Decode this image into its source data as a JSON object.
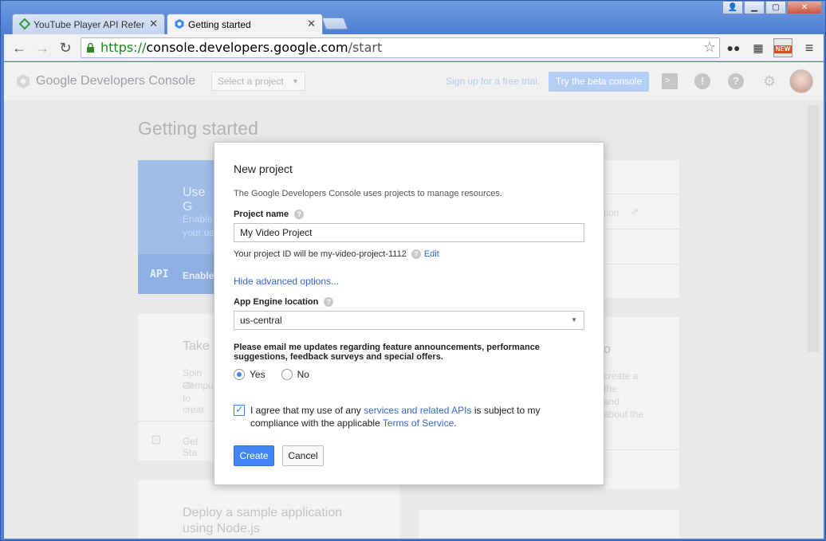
{
  "browser": {
    "tabs": [
      {
        "title": "YouTube Player API Referen",
        "active": false
      },
      {
        "title": "Getting started",
        "active": true
      }
    ],
    "url": {
      "scheme": "https://",
      "host": "console.developers.google.com",
      "path": "/start"
    },
    "extension_new_badge": "NEW"
  },
  "appbar": {
    "brand": "Google Developers Console",
    "project_select_placeholder": "Select a project",
    "signup_text": "Sign up for a free trial.",
    "beta_button": "Try the beta console"
  },
  "background": {
    "heading": "Getting started",
    "card1_title": "Use G",
    "card1_line1": "Enable",
    "card1_line2": "your us",
    "card1_api": "API",
    "card1_footer": "Enable",
    "card2_title": "Take",
    "card2_line1": "Spin up",
    "card2_line2": "Compu",
    "card2_line3": "to creat",
    "card2_footer": "Get Sta",
    "card3_title": "Deploy a sample application",
    "card3_line2": "using Node.js",
    "right1_text": "tion",
    "right2_title": "o",
    "right2_line1": "create a",
    "right2_line2": "the",
    "right2_line3": "and",
    "right2_line4": "about the"
  },
  "dialog": {
    "title": "New project",
    "description": "The Google Developers Console uses projects to manage resources.",
    "project_name_label": "Project name",
    "project_name_value": "My Video Project",
    "project_id_text": "Your project ID will be my-video-project-1112",
    "edit_link": "Edit",
    "advanced_link": "Hide advanced options...",
    "app_engine_label": "App Engine location",
    "app_engine_value": "us-central",
    "email_prompt": "Please email me updates regarding feature announcements, performance suggestions, feedback surveys and special offers.",
    "radio_yes": "Yes",
    "radio_no": "No",
    "radio_selected": "Yes",
    "agree_prefix": "I agree that my use of any ",
    "agree_link1": "services and related APIs",
    "agree_middle": " is subject to my compliance with the applicable ",
    "agree_link2": "Terms of Service",
    "agree_suffix": ".",
    "agree_checked": true,
    "create_button": "Create",
    "cancel_button": "Cancel"
  },
  "colors": {
    "accent": "#4285f4",
    "link": "#3367d6",
    "https_green": "#1a8a1a"
  }
}
